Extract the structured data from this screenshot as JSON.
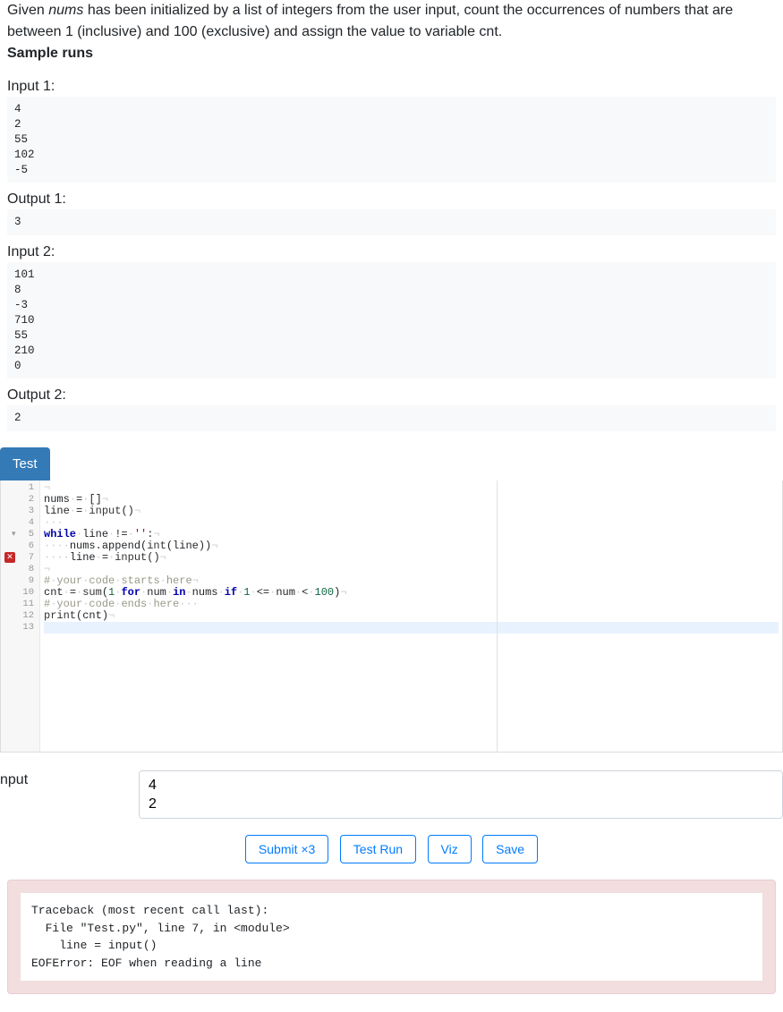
{
  "problem": {
    "prefix": "Given ",
    "varname": "nums",
    "rest": " has been initialized by a list of integers from the user input, count the occurrences of numbers that are between 1 (inclusive) and 100 (exclusive) and assign the value to variable cnt."
  },
  "sample_runs_label": "Sample runs",
  "samples": {
    "input1_label": "Input 1:",
    "input1": "4\n2\n55\n102\n-5",
    "output1_label": "Output 1:",
    "output1": "3",
    "input2_label": "Input 2:",
    "input2": "101\n8\n-3\n710\n55\n210\n0",
    "output2_label": "Output 2:",
    "output2": "2"
  },
  "tab_label": "Test",
  "editor": {
    "line_numbers": [
      "1",
      "2",
      "3",
      "4",
      "5",
      "6",
      "7",
      "8",
      "9",
      "10",
      "11",
      "12",
      "13"
    ],
    "error_line": 7,
    "fold_line": 5,
    "highlight_line": 13,
    "code_plain": "\nnums = []\nline = input()\n\nwhile line != '':\n    nums.append(int(line))\n    line = input()\n\n# your code starts here\ncnt = sum(1 for num in nums if 1 <= num < 100)\n# your code ends here\nprint(cnt)\n"
  },
  "input_section": {
    "label": "nput",
    "value": "4\n2"
  },
  "buttons": {
    "submit": "Submit ×3",
    "testrun": "Test Run",
    "viz": "Viz",
    "save": "Save"
  },
  "error_output": "Traceback (most recent call last):\n  File \"Test.py\", line 7, in <module>\n    line = input()\nEOFError: EOF when reading a line"
}
